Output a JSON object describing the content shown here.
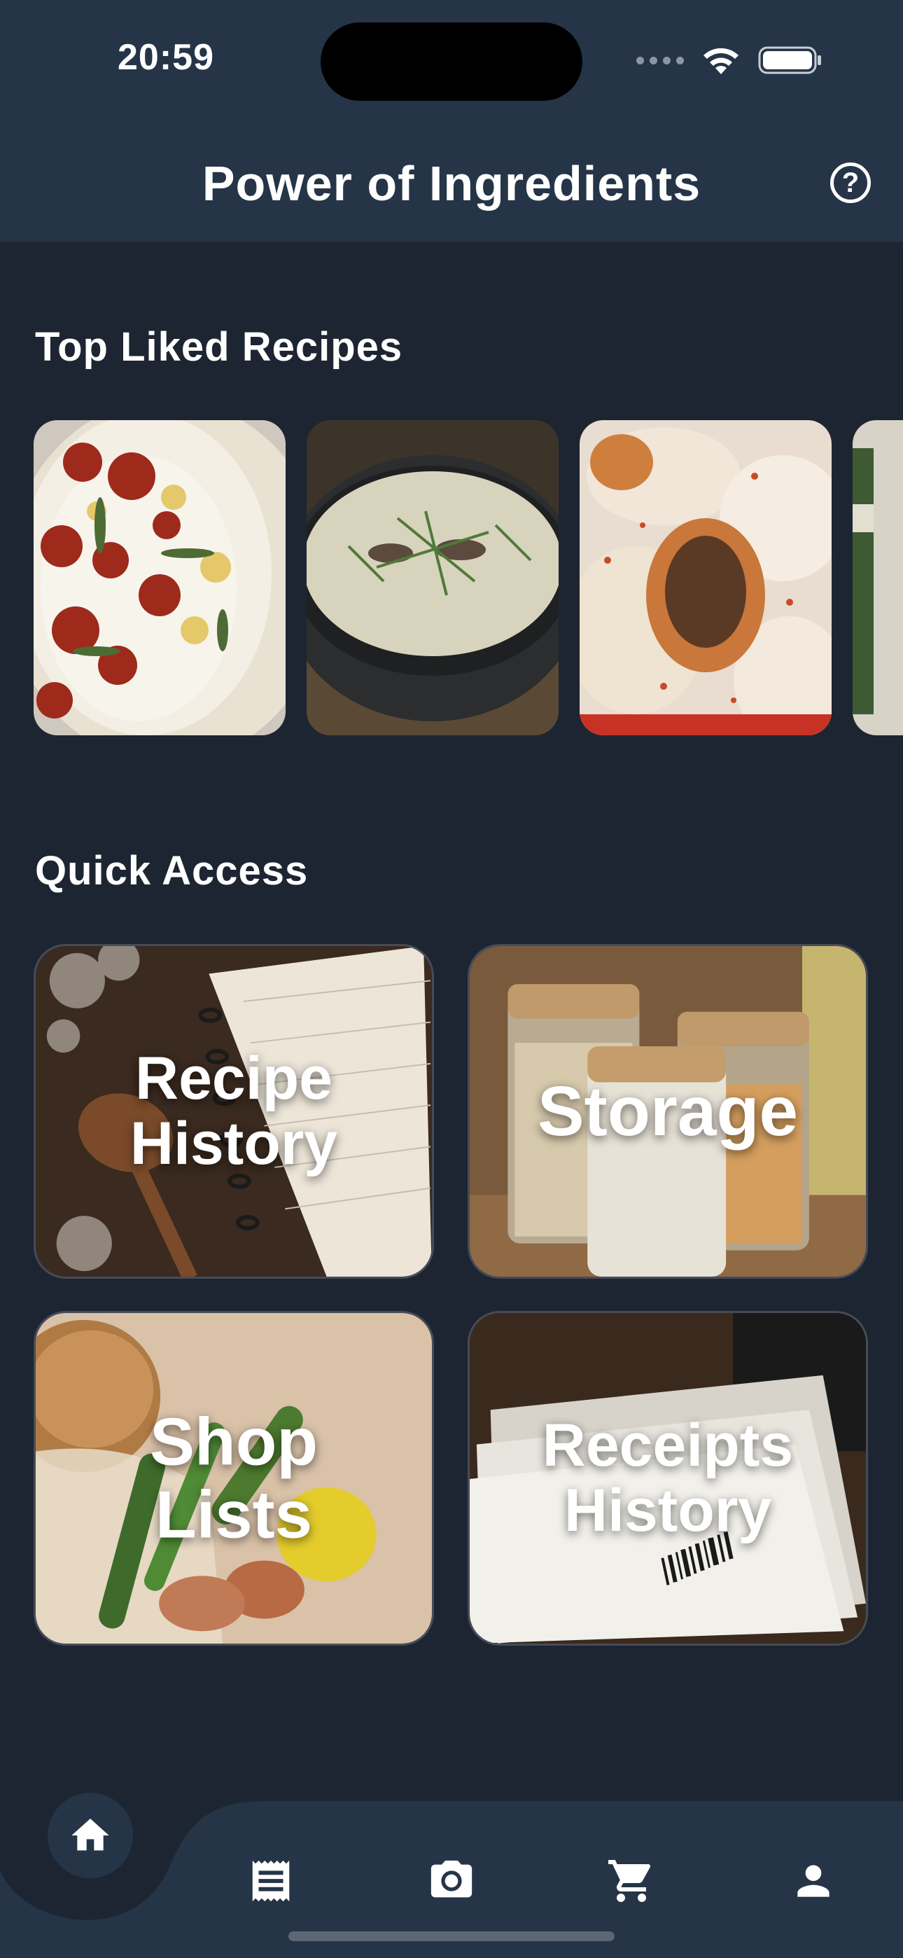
{
  "status_bar": {
    "time": "20:59"
  },
  "header": {
    "title": "Power of Ingredients",
    "help_icon": "help-circle-icon"
  },
  "top_liked": {
    "title": "Top Liked Recipes",
    "recipes": [
      {
        "name": "recipe-1"
      },
      {
        "name": "recipe-2"
      },
      {
        "name": "recipe-3"
      },
      {
        "name": "recipe-4"
      }
    ]
  },
  "quick_access": {
    "title": "Quick Access",
    "tiles": [
      {
        "label": "Recipe History"
      },
      {
        "label": "Storage"
      },
      {
        "label": "Shop Lists"
      },
      {
        "label": "Receipts History"
      }
    ]
  },
  "bottom_nav": {
    "items": [
      "home-icon",
      "receipt-icon",
      "camera-icon",
      "cart-icon",
      "profile-icon"
    ],
    "active": "home-icon"
  },
  "colors": {
    "header": "#253547",
    "background": "#1e2532",
    "nav": "#253547"
  }
}
